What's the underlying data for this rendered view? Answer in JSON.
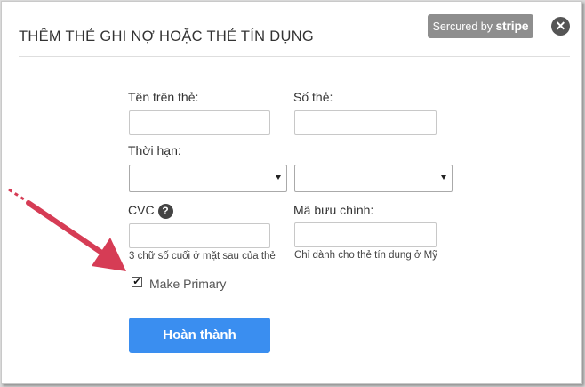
{
  "modal": {
    "title": "THÊM THẺ GHI NỢ HOẶC THẺ TÍN DỤNG",
    "stripe_badge": {
      "prefix": "Sercured by",
      "brand": "stripe"
    },
    "close_icon": "close-icon"
  },
  "form": {
    "name_label": "Tên trên thẻ:",
    "name_value": "",
    "card_number_label": "Số thẻ:",
    "card_number_value": "",
    "expiry_label": "Thời hạn:",
    "expiry_month_value": "",
    "expiry_year_value": "",
    "cvc_label": "CVC",
    "cvc_value": "",
    "cvc_hint": "3 chữ số cuối ở mặt sau của thẻ",
    "zip_label": "Mã bưu chính:",
    "zip_value": "",
    "zip_hint": "Chỉ dành cho thẻ tín dụng ở Mỹ",
    "make_primary_label": "Make Primary",
    "make_primary_checked": true,
    "submit_label": "Hoàn thành"
  },
  "colors": {
    "button": "#3a8ef0",
    "annotation_arrow": "#d63c55",
    "badge": "#8e8e8e"
  }
}
